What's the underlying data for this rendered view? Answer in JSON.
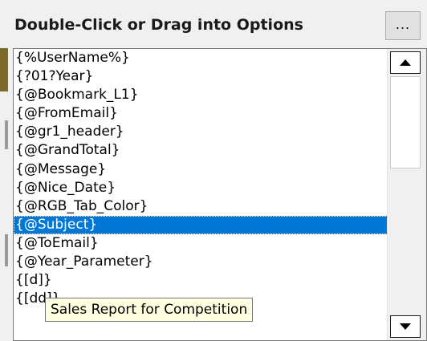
{
  "header": {
    "title": "Double-Click or Drag into Options",
    "more_label": "..."
  },
  "list": {
    "items": [
      "{%UserName%}",
      "{?01?Year}",
      "{@Bookmark_L1}",
      "{@FromEmail}",
      "{@gr1_header}",
      "{@GrandTotal}",
      "{@Message}",
      "{@Nice_Date}",
      "{@RGB_Tab_Color}",
      "{@Subject}",
      "{@ToEmail}",
      "{@Year_Parameter}",
      "{[d]}",
      "{[dd]}"
    ],
    "selected_index": 9
  },
  "tooltip": {
    "text": "Sales Report for Competition"
  },
  "scrollbar": {
    "up_icon": "triangle-up-icon",
    "down_icon": "triangle-down-icon"
  },
  "colors": {
    "selection": "#0078d7",
    "tooltip_bg": "#ffffe1",
    "panel_bg": "#f0f0f0"
  }
}
